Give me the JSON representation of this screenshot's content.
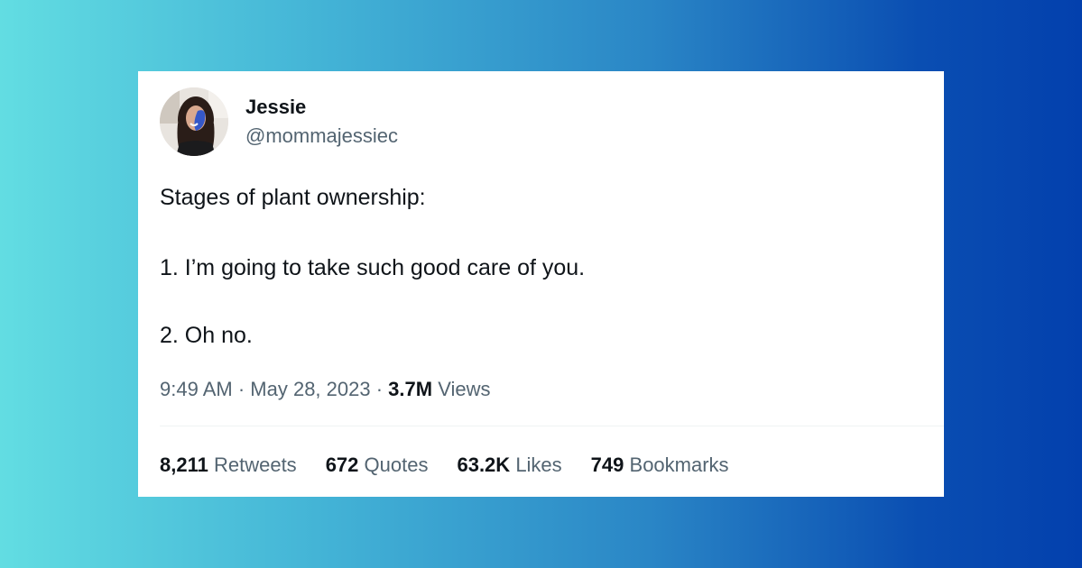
{
  "tweet": {
    "author": {
      "display_name": "Jessie",
      "handle": "@mommajessiec",
      "avatar_icon": "user-avatar"
    },
    "text_lines": [
      "Stages of plant ownership:",
      "1. I’m going to take such good care of you.",
      "2. Oh no."
    ],
    "meta": {
      "time": "9:49 AM",
      "separator": " · ",
      "date": "May 28, 2023",
      "views_count": "3.7M",
      "views_label": "Views"
    },
    "stats": [
      {
        "count": "8,211",
        "label": "Retweets"
      },
      {
        "count": "672",
        "label": "Quotes"
      },
      {
        "count": "63.2K",
        "label": "Likes"
      },
      {
        "count": "749",
        "label": "Bookmarks"
      }
    ]
  },
  "colors": {
    "text_primary": "#0f1419",
    "text_secondary": "#536471",
    "divider": "#eff3f4",
    "gradient_start": "#62dde2",
    "gradient_end": "#0340ad"
  }
}
